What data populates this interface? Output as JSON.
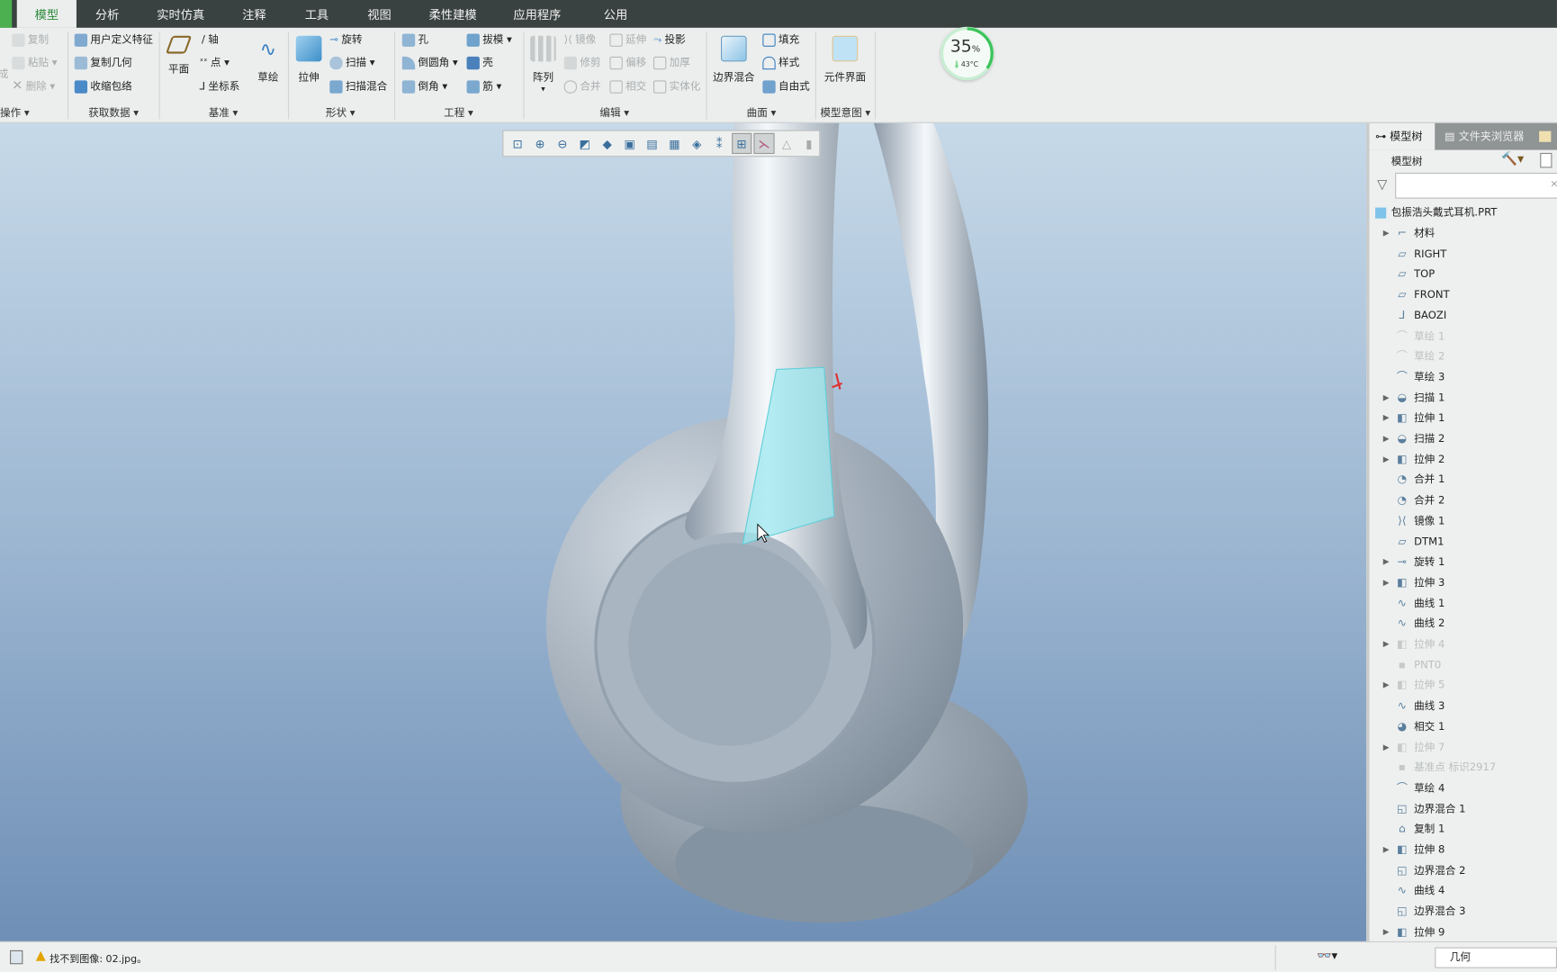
{
  "tabs": [
    "模型",
    "分析",
    "实时仿真",
    "注释",
    "工具",
    "视图",
    "柔性建模",
    "应用程序",
    "公用"
  ],
  "active_tab": "模型",
  "ribbon": {
    "groups": [
      "操作 ▾",
      "获取数据 ▾",
      "基准 ▾",
      "形状 ▾",
      "工程 ▾",
      "编辑 ▾",
      "曲面 ▾",
      "模型意图 ▾"
    ],
    "operate": {
      "cut_label": "成",
      "copy": "复制",
      "paste": "粘贴 ▾",
      "delete": "删除 ▾"
    },
    "getdata": {
      "udf": "用户定义特征",
      "copy_geom": "复制几何",
      "shrinkwrap": "收缩包络"
    },
    "datum": {
      "plane": "平面",
      "axis": "轴",
      "point": "点 ▾",
      "csys": "坐标系",
      "sketch": "草绘"
    },
    "shape": {
      "extrude": "拉伸",
      "revolve": "旋转",
      "sweep": "扫描 ▾",
      "swept_blend": "扫描混合"
    },
    "engineering": {
      "hole": "孔",
      "round": "倒圆角 ▾",
      "chamfer": "倒角 ▾",
      "draft": "拔模 ▾",
      "shell": "壳",
      "rib": "筋 ▾"
    },
    "editing": {
      "pattern": "阵列",
      "mirror": "镜像",
      "extend": "延伸",
      "project": "投影",
      "trim": "修剪",
      "offset": "偏移",
      "thicken": "加厚",
      "merge": "合并",
      "intersect": "相交",
      "solidify": "实体化"
    },
    "surfaces": {
      "boundary_blend": "边界混合",
      "fill": "填充",
      "style": "样式",
      "freestyle": "自由式"
    },
    "intent": {
      "component_interface": "元件界面"
    }
  },
  "monitor": {
    "percent": "35",
    "unit": "%",
    "temp": "43°C",
    "accent": "#3cc35a"
  },
  "panel": {
    "tabs": [
      "模型树",
      "文件夹浏览器"
    ],
    "title": "模型树",
    "filter_placeholder": "",
    "root": "包振浩头戴式耳机.PRT",
    "items": [
      {
        "label": "材料",
        "icon": "material",
        "exp": true
      },
      {
        "label": "RIGHT",
        "icon": "plane"
      },
      {
        "label": "TOP",
        "icon": "plane"
      },
      {
        "label": "FRONT",
        "icon": "plane"
      },
      {
        "label": "BAOZI",
        "icon": "csys"
      },
      {
        "label": "草绘 1",
        "icon": "sketch",
        "dim": true
      },
      {
        "label": "草绘 2",
        "icon": "sketch",
        "dim": true
      },
      {
        "label": "草绘 3",
        "icon": "sketch"
      },
      {
        "label": "扫描 1",
        "icon": "sweep",
        "exp": true
      },
      {
        "label": "拉伸 1",
        "icon": "extrude",
        "exp": true
      },
      {
        "label": "扫描 2",
        "icon": "sweep",
        "exp": true
      },
      {
        "label": "拉伸 2",
        "icon": "extrude",
        "exp": true
      },
      {
        "label": "合并 1",
        "icon": "merge"
      },
      {
        "label": "合并 2",
        "icon": "merge"
      },
      {
        "label": "镜像 1",
        "icon": "mirror"
      },
      {
        "label": "DTM1",
        "icon": "plane"
      },
      {
        "label": "旋转 1",
        "icon": "revolve",
        "exp": true
      },
      {
        "label": "拉伸 3",
        "icon": "extrude",
        "exp": true
      },
      {
        "label": "曲线 1",
        "icon": "curve"
      },
      {
        "label": "曲线 2",
        "icon": "curve"
      },
      {
        "label": "拉伸 4",
        "icon": "extrude",
        "exp": true,
        "dim": true
      },
      {
        "label": "PNT0",
        "icon": "point",
        "dim": true
      },
      {
        "label": "拉伸 5",
        "icon": "extrude",
        "exp": true,
        "dim": true
      },
      {
        "label": "曲线 3",
        "icon": "curve"
      },
      {
        "label": "相交 1",
        "icon": "intersect"
      },
      {
        "label": "拉伸 7",
        "icon": "extrude",
        "exp": true,
        "dim": true
      },
      {
        "label": "基准点 标识2917",
        "icon": "point",
        "dim": true
      },
      {
        "label": "草绘 4",
        "icon": "sketch"
      },
      {
        "label": "边界混合 1",
        "icon": "boundary"
      },
      {
        "label": "复制 1",
        "icon": "copy"
      },
      {
        "label": "拉伸 8",
        "icon": "extrude",
        "exp": true
      },
      {
        "label": "边界混合 2",
        "icon": "boundary"
      },
      {
        "label": "曲线 4",
        "icon": "curve"
      },
      {
        "label": "边界混合 3",
        "icon": "boundary"
      },
      {
        "label": "拉伸 9",
        "icon": "extrude",
        "exp": true
      }
    ]
  },
  "status": {
    "message": "找不到图像: 02.jpg。",
    "filter_value": "几何"
  }
}
